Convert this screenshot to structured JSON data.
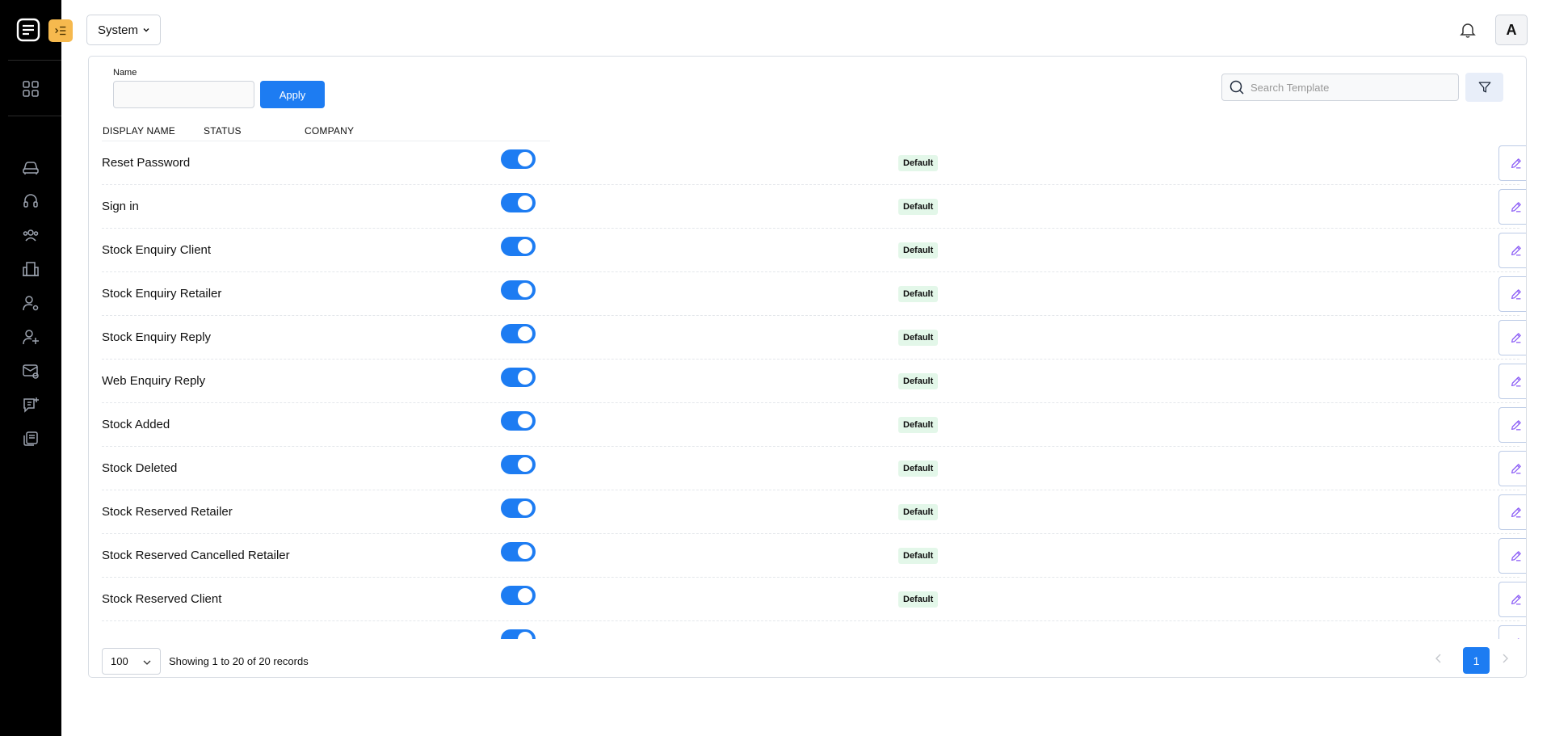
{
  "header": {
    "system_label": "System",
    "avatar_initial": "A"
  },
  "filters": {
    "name_label": "Name",
    "name_value": "",
    "apply_label": "Apply",
    "search_placeholder": "Search Template"
  },
  "table": {
    "columns": [
      "DISPLAY NAME",
      "STATUS",
      "COMPANY"
    ],
    "rows": [
      {
        "name": "Reset Password",
        "enabled": true,
        "badge": "Default"
      },
      {
        "name": "Sign in",
        "enabled": true,
        "badge": "Default"
      },
      {
        "name": "Stock Enquiry Client",
        "enabled": true,
        "badge": "Default"
      },
      {
        "name": "Stock Enquiry Retailer",
        "enabled": true,
        "badge": "Default"
      },
      {
        "name": "Stock Enquiry Reply",
        "enabled": true,
        "badge": "Default"
      },
      {
        "name": "Web Enquiry Reply",
        "enabled": true,
        "badge": "Default"
      },
      {
        "name": "Stock Added",
        "enabled": true,
        "badge": "Default"
      },
      {
        "name": "Stock Deleted",
        "enabled": true,
        "badge": "Default"
      },
      {
        "name": "Stock Reserved Retailer",
        "enabled": true,
        "badge": "Default"
      },
      {
        "name": "Stock Reserved Cancelled Retailer",
        "enabled": true,
        "badge": "Default"
      },
      {
        "name": "Stock Reserved Client",
        "enabled": true,
        "badge": "Default"
      },
      {
        "name": "",
        "enabled": true,
        "badge": ""
      }
    ]
  },
  "footer": {
    "per_page": "100",
    "showing_text": "Showing 1 to 20 of 20 records",
    "current_page": "1"
  },
  "colors": {
    "accent": "#1d7cf2",
    "sidebar_bg": "#000000",
    "collapse_btn": "#f6b94e",
    "badge_bg": "#e3f7e9",
    "edit_icon": "#8b5cf6"
  },
  "icons": {
    "sidebar": [
      "dashboard-icon",
      "car-icon",
      "headset-icon",
      "users-icon",
      "building-icon",
      "user-settings-icon",
      "user-plus-icon",
      "mail-settings-icon",
      "message-plus-icon",
      "templates-icon"
    ]
  }
}
